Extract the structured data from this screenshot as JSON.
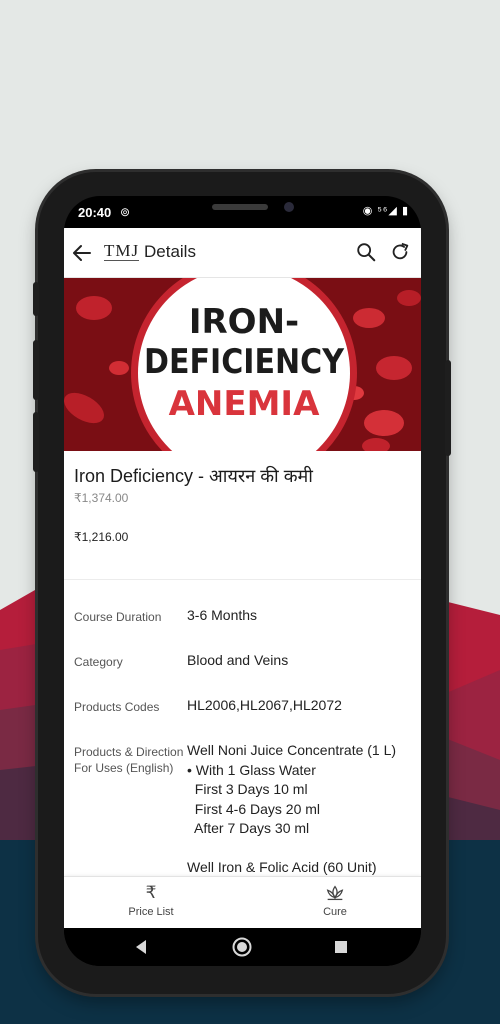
{
  "status_bar": {
    "time": "20:40",
    "sync_icon": "sync-icon",
    "right_icons": "◉ ⁵⁶◢ ▮"
  },
  "app_bar": {
    "logo": "TMJ",
    "title": "Details"
  },
  "banner": {
    "line1": "IRON-",
    "line2": "DEFICIENCY",
    "line3": "ANEMIA"
  },
  "product": {
    "name": "Iron Deficiency - आयरन की कमी",
    "price_old": "₹1,374.00",
    "price_new": "₹1,216.00"
  },
  "details": [
    {
      "label": "Course Duration",
      "value": "3-6 Months"
    },
    {
      "label": "Category",
      "value": "Blood and Veins"
    },
    {
      "label": "Products Codes",
      "value": "HL2006,HL2067,HL2072"
    },
    {
      "label": "Products & Direction For Uses (English)",
      "value": "Well Noni Juice Concentrate (1 L)\n• With 1 Glass Water\n  First 3 Days 10 ml\n  First 4-6 Days 20 ml\n  After 7 Days 30 ml\n\nWell Iron & Folic Acid (60 Unit)"
    }
  ],
  "bottom_nav": [
    {
      "icon": "₹",
      "label": "Price List"
    },
    {
      "icon": "lotus-icon",
      "label": "Cure"
    }
  ],
  "colors": {
    "banner_red": "#c5242f",
    "mountain_red": "#b01e3c",
    "mountain_dark": "#0d3145"
  }
}
